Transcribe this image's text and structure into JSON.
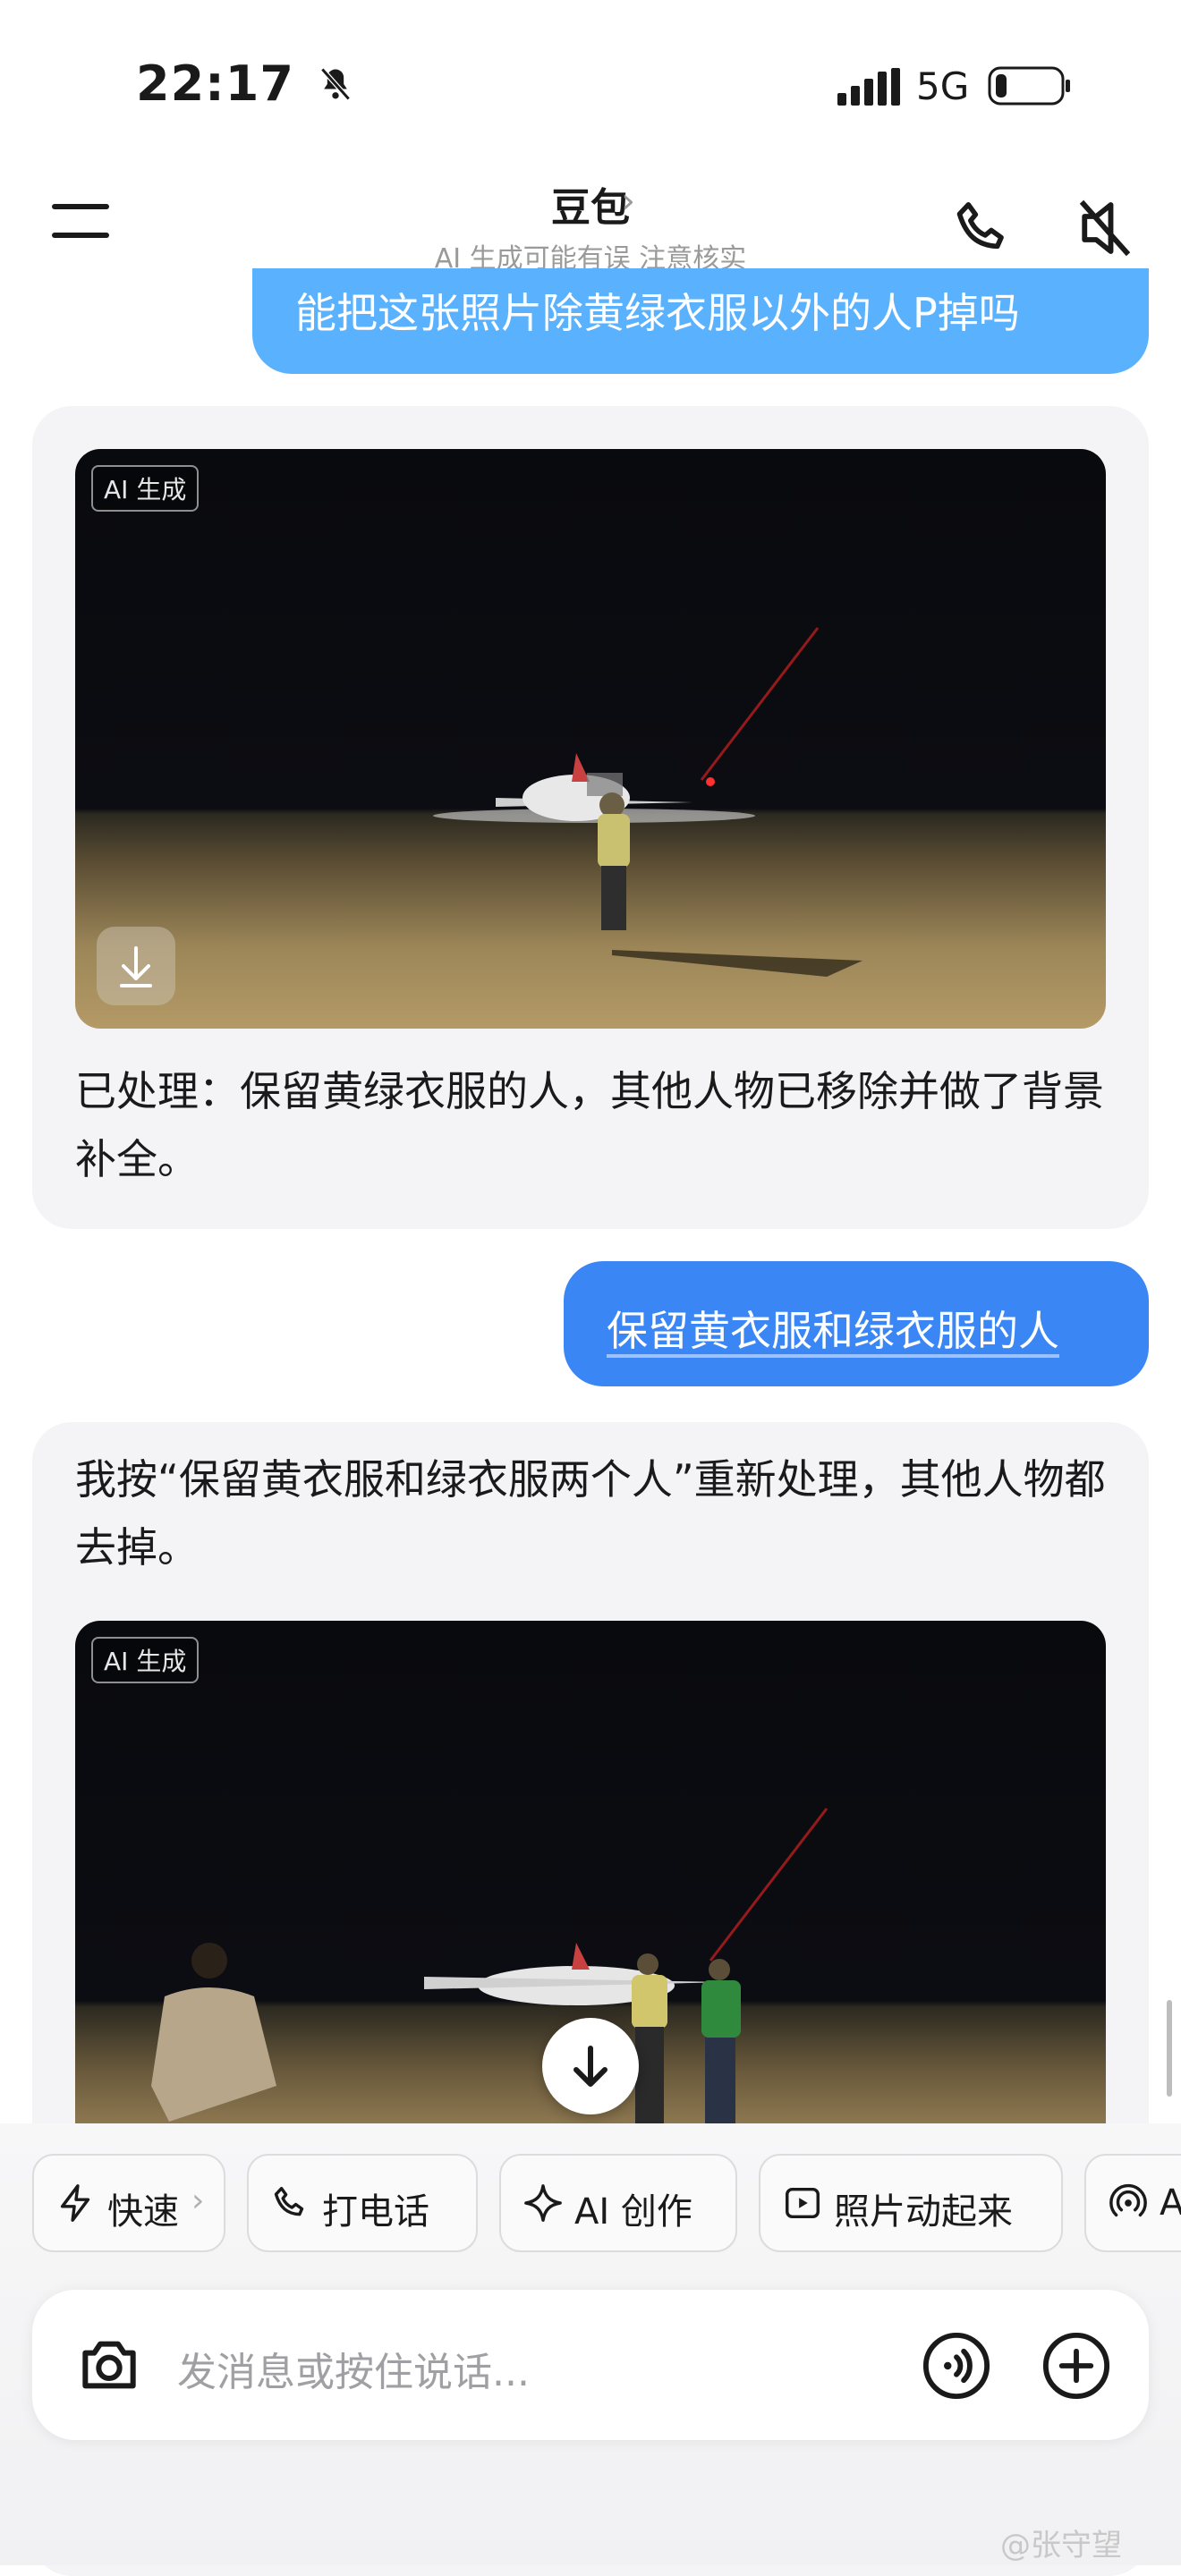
{
  "status_bar": {
    "time": "22:17",
    "network": "5G"
  },
  "header": {
    "title": "豆包",
    "title_chevron": "›",
    "subtitle": "AI 生成可能有误 注意核实"
  },
  "messages": {
    "user_1": "能把这张照片除黄绿衣服以外的人P掉吗",
    "assistant_1": {
      "badge": "AI 生成",
      "text": "已处理：保留黄绿衣服的人，其他人物已移除并做了背景补全。"
    },
    "user_2": "保留黄衣服和绿衣服的人",
    "assistant_2": {
      "text": "我按“保留黄衣服和绿衣服两个人”重新处理，其他人物都去掉。",
      "badge": "AI 生成"
    }
  },
  "quick_actions": [
    {
      "label": "快速",
      "chevron": "›",
      "icon": "lightning-icon"
    },
    {
      "label": "打电话",
      "icon": "phone-icon"
    },
    {
      "label": "AI 创作",
      "icon": "sparkle-icon"
    },
    {
      "label": "照片动起来",
      "icon": "play-icon"
    },
    {
      "label": "A",
      "icon": "broadcast-icon"
    }
  ],
  "input": {
    "placeholder": "发消息或按住说话..."
  },
  "watermark": "@张守望"
}
